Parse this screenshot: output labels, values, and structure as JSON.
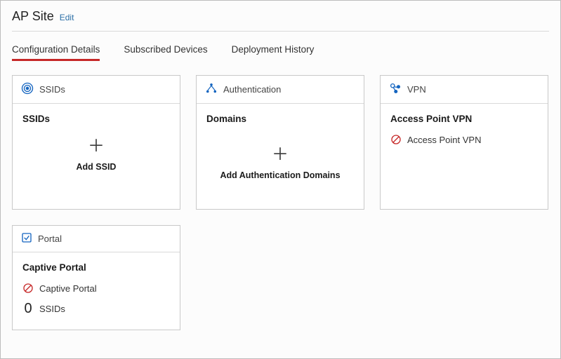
{
  "header": {
    "title": "AP Site",
    "edit_label": "Edit"
  },
  "tabs": [
    {
      "label": "Configuration Details",
      "active": true
    },
    {
      "label": "Subscribed Devices",
      "active": false
    },
    {
      "label": "Deployment History",
      "active": false
    }
  ],
  "cards": {
    "ssids": {
      "head": "SSIDs",
      "subtitle": "SSIDs",
      "add_label": "Add SSID"
    },
    "auth": {
      "head": "Authentication",
      "subtitle": "Domains",
      "add_label": "Add Authentication Domains"
    },
    "vpn": {
      "head": "VPN",
      "subtitle": "Access Point VPN",
      "status_label": "Access Point VPN"
    },
    "portal": {
      "head": "Portal",
      "subtitle": "Captive Portal",
      "status_label": "Captive Portal",
      "ssids_count": "0",
      "ssids_label": "SSIDs"
    }
  }
}
